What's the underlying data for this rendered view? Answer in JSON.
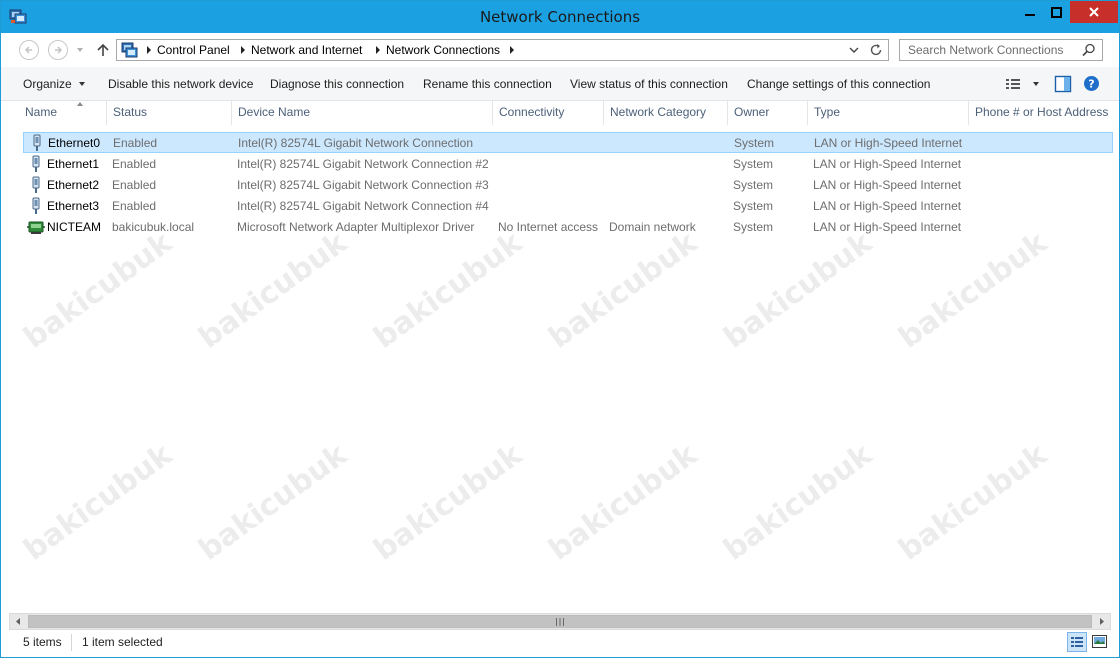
{
  "window": {
    "title": "Network Connections",
    "icons": {
      "app": "network-connections-icon",
      "minimize": "minimize-icon",
      "maximize": "maximize-icon",
      "close": "close-icon"
    },
    "colors": {
      "titlebar": "#1ba1e2",
      "close": "#c7302a",
      "selection": "#cce8ff"
    }
  },
  "address_bar": {
    "breadcrumbs": [
      "Control Panel",
      "Network and Internet",
      "Network Connections"
    ],
    "search_placeholder": "Search Network Connections",
    "icons": {
      "back": "back-arrow-icon",
      "forward": "forward-arrow-icon",
      "up": "up-arrow-icon",
      "refresh": "refresh-icon",
      "search": "search-icon"
    }
  },
  "toolbar": {
    "organize": "Organize",
    "disable": "Disable this network device",
    "diagnose": "Diagnose this connection",
    "rename": "Rename this connection",
    "view_status": "View status of this connection",
    "change_settings": "Change settings of this connection",
    "icons": {
      "view_options": "view-options-icon",
      "preview_pane": "preview-pane-icon",
      "help": "help-icon"
    }
  },
  "columns": [
    "Name",
    "Status",
    "Device Name",
    "Connectivity",
    "Network Category",
    "Owner",
    "Type",
    "Phone # or Host Address"
  ],
  "connections": [
    {
      "name": "Ethernet0",
      "status": "Enabled",
      "device": "Intel(R) 82574L Gigabit Network Connection",
      "connectivity": "",
      "category": "",
      "owner": "System",
      "type": "LAN or High-Speed Internet",
      "phone": "",
      "icon": "ethernet-adapter-icon",
      "selected": true
    },
    {
      "name": "Ethernet1",
      "status": "Enabled",
      "device": "Intel(R) 82574L Gigabit Network Connection #2",
      "connectivity": "",
      "category": "",
      "owner": "System",
      "type": "LAN or High-Speed Internet",
      "phone": "",
      "icon": "ethernet-adapter-icon",
      "selected": false
    },
    {
      "name": "Ethernet2",
      "status": "Enabled",
      "device": "Intel(R) 82574L Gigabit Network Connection #3",
      "connectivity": "",
      "category": "",
      "owner": "System",
      "type": "LAN or High-Speed Internet",
      "phone": "",
      "icon": "ethernet-adapter-icon",
      "selected": false
    },
    {
      "name": "Ethernet3",
      "status": "Enabled",
      "device": "Intel(R) 82574L Gigabit Network Connection #4",
      "connectivity": "",
      "category": "",
      "owner": "System",
      "type": "LAN or High-Speed Internet",
      "phone": "",
      "icon": "ethernet-adapter-icon",
      "selected": false
    },
    {
      "name": "NICTEAM",
      "status": "bakicubuk.local",
      "device": "Microsoft Network Adapter Multiplexor Driver",
      "connectivity": "No Internet access",
      "category": "Domain network",
      "owner": "System",
      "type": "LAN or High-Speed Internet",
      "phone": "",
      "icon": "nic-team-icon",
      "selected": false
    }
  ],
  "watermark": "bakicubuk",
  "status_bar": {
    "item_count": "5 items",
    "selection": "1 item selected",
    "icons": {
      "details": "details-view-icon",
      "tiles": "large-icons-view-icon"
    }
  }
}
